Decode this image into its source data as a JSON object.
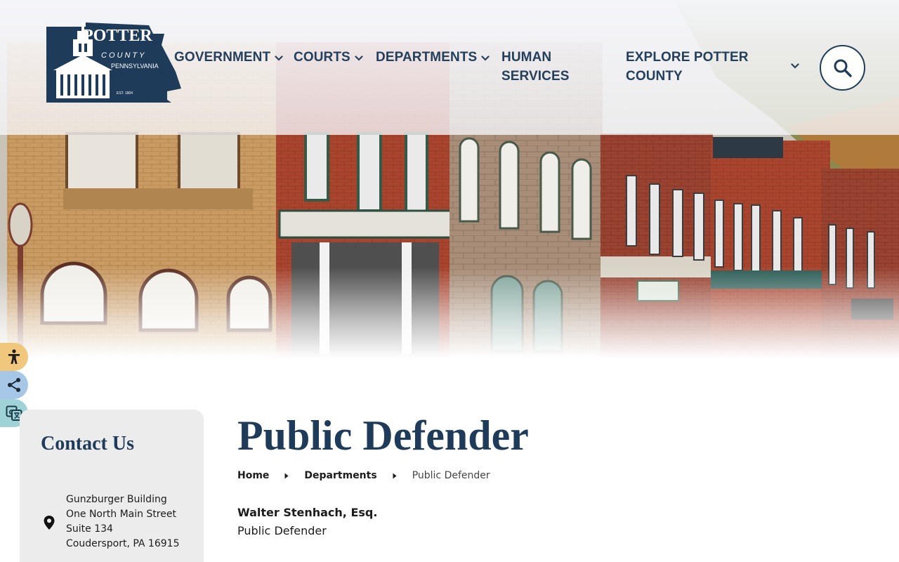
{
  "brand": {
    "logo_line1": "POTTER",
    "logo_line2": "COUNTY",
    "logo_line3": "PENNSYLVANIA",
    "logo_est": "EST. 1804",
    "navy": "#1f3b5a"
  },
  "nav": {
    "items": [
      {
        "label": "GOVERNMENT",
        "has_dropdown": true
      },
      {
        "label": "COURTS",
        "has_dropdown": true
      },
      {
        "label": "DEPARTMENTS",
        "has_dropdown": true
      },
      {
        "label": "HUMAN SERVICES",
        "line1": "HUMAN",
        "line2": "SERVICES",
        "has_dropdown": false
      },
      {
        "label": "EXPLORE POTTER COUNTY",
        "line1": "EXPLORE POTTER",
        "line2": "COUNTY",
        "has_dropdown": true
      }
    ],
    "search_icon": "search-icon"
  },
  "tools": {
    "items": [
      "accessibility-icon",
      "share-icon",
      "translate-icon"
    ]
  },
  "sidebar": {
    "title": "Contact Us",
    "address_icon": "map-pin-icon",
    "address": [
      "Gunzburger Building",
      "One North Main Street",
      "Suite 134",
      "Coudersport, PA 16915"
    ]
  },
  "main": {
    "title": "Public Defender",
    "breadcrumb": [
      {
        "label": "Home",
        "link": true
      },
      {
        "label": "Departments",
        "link": true
      },
      {
        "label": "Public Defender",
        "link": false
      }
    ],
    "person_name": "Walter Stenhach, Esq.",
    "person_role": "Public Defender"
  }
}
